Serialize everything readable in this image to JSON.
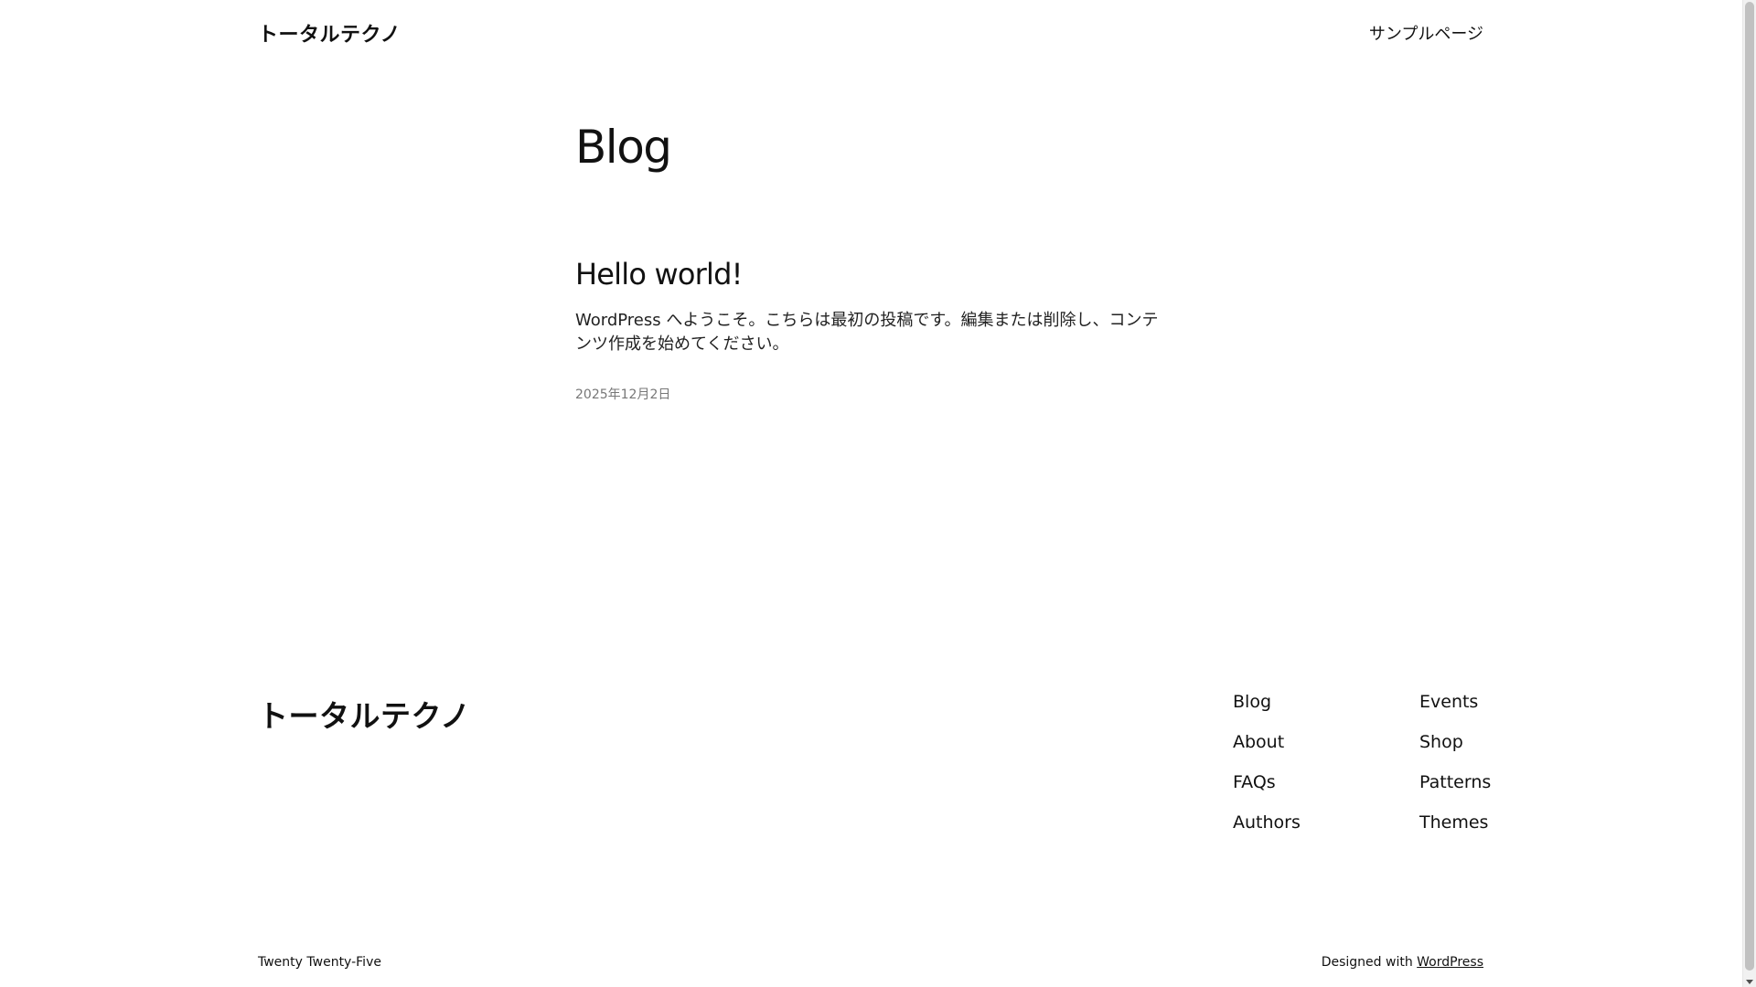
{
  "header": {
    "site_title": "トータルテクノ",
    "nav_items": [
      {
        "label": "サンプルページ"
      }
    ]
  },
  "main": {
    "heading": "Blog",
    "posts": [
      {
        "title": "Hello world!",
        "excerpt": "WordPress へようこそ。こちらは最初の投稿です。編集または削除し、コンテンツ作成を始めてください。",
        "date": "2025年12月2日"
      }
    ]
  },
  "footer": {
    "site_title": "トータルテクノ",
    "nav_left": [
      {
        "label": "Blog"
      },
      {
        "label": "About"
      },
      {
        "label": "FAQs"
      },
      {
        "label": "Authors"
      }
    ],
    "nav_right": [
      {
        "label": "Events"
      },
      {
        "label": "Shop"
      },
      {
        "label": "Patterns"
      },
      {
        "label": "Themes"
      }
    ],
    "theme_credit": "Twenty Twenty-Five",
    "designed_with_prefix": "Designed with ",
    "designed_with_link": "WordPress"
  }
}
